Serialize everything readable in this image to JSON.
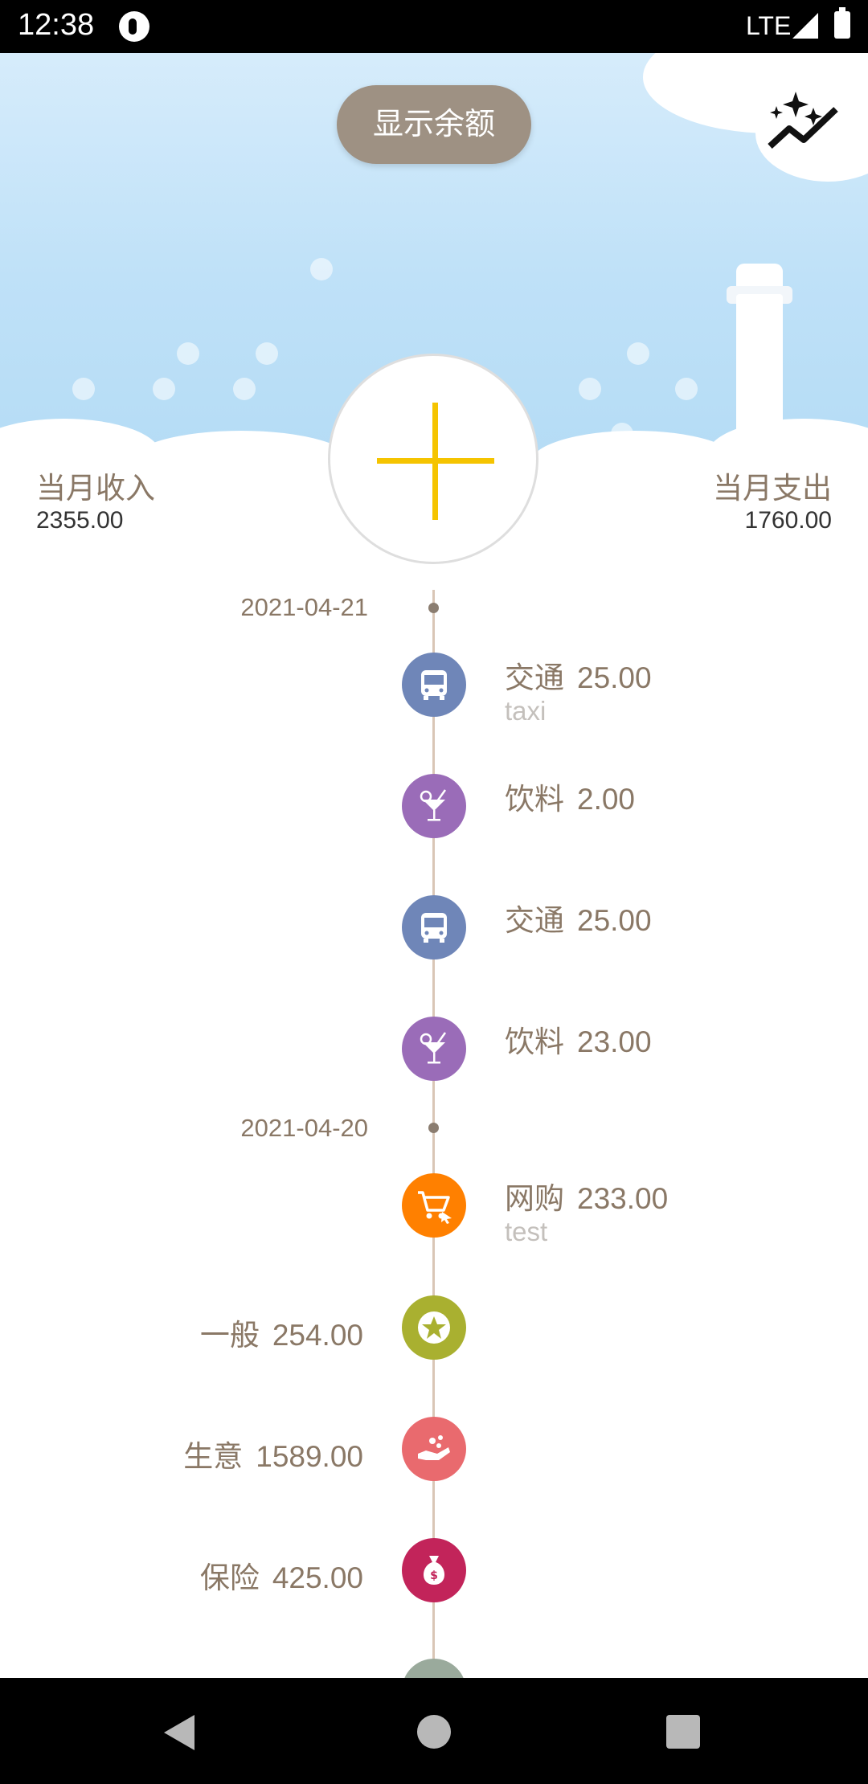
{
  "status_bar": {
    "time": "12:38",
    "network": "LTE"
  },
  "header": {
    "show_balance_label": "显示余额",
    "trend_icon": "sparkle-trend-icon"
  },
  "summary": {
    "income_label": "当月收入",
    "income_value": "2355.00",
    "expense_label": "当月支出",
    "expense_value": "1760.00"
  },
  "timeline": {
    "dates": [
      "2021-04-21",
      "2021-04-20"
    ],
    "entries": [
      {
        "category": "交通",
        "amount": "25.00",
        "note": "taxi",
        "side": "right",
        "icon": "bus-icon",
        "color": "#6f86b8"
      },
      {
        "category": "饮料",
        "amount": "2.00",
        "note": "",
        "side": "right",
        "icon": "cocktail-icon",
        "color": "#9a6cb8"
      },
      {
        "category": "交通",
        "amount": "25.00",
        "note": "",
        "side": "right",
        "icon": "bus-icon",
        "color": "#6f86b8"
      },
      {
        "category": "饮料",
        "amount": "23.00",
        "note": "",
        "side": "right",
        "icon": "cocktail-icon",
        "color": "#9a6cb8"
      },
      {
        "category": "网购",
        "amount": "233.00",
        "note": "test",
        "side": "right",
        "icon": "cart-icon",
        "color": "#ff8000"
      },
      {
        "category": "一般",
        "amount": "254.00",
        "note": "",
        "side": "left",
        "icon": "star-icon",
        "color": "#a9b030"
      },
      {
        "category": "生意",
        "amount": "1589.00",
        "note": "",
        "side": "left",
        "icon": "hand-coins-icon",
        "color": "#e96a6e"
      },
      {
        "category": "保险",
        "amount": "425.00",
        "note": "",
        "side": "left",
        "icon": "money-bag-icon",
        "color": "#c2245a"
      }
    ]
  },
  "colors": {
    "accent_plus": "#f5c400",
    "text_brown": "#8a7866",
    "pill": "#9e9183"
  }
}
